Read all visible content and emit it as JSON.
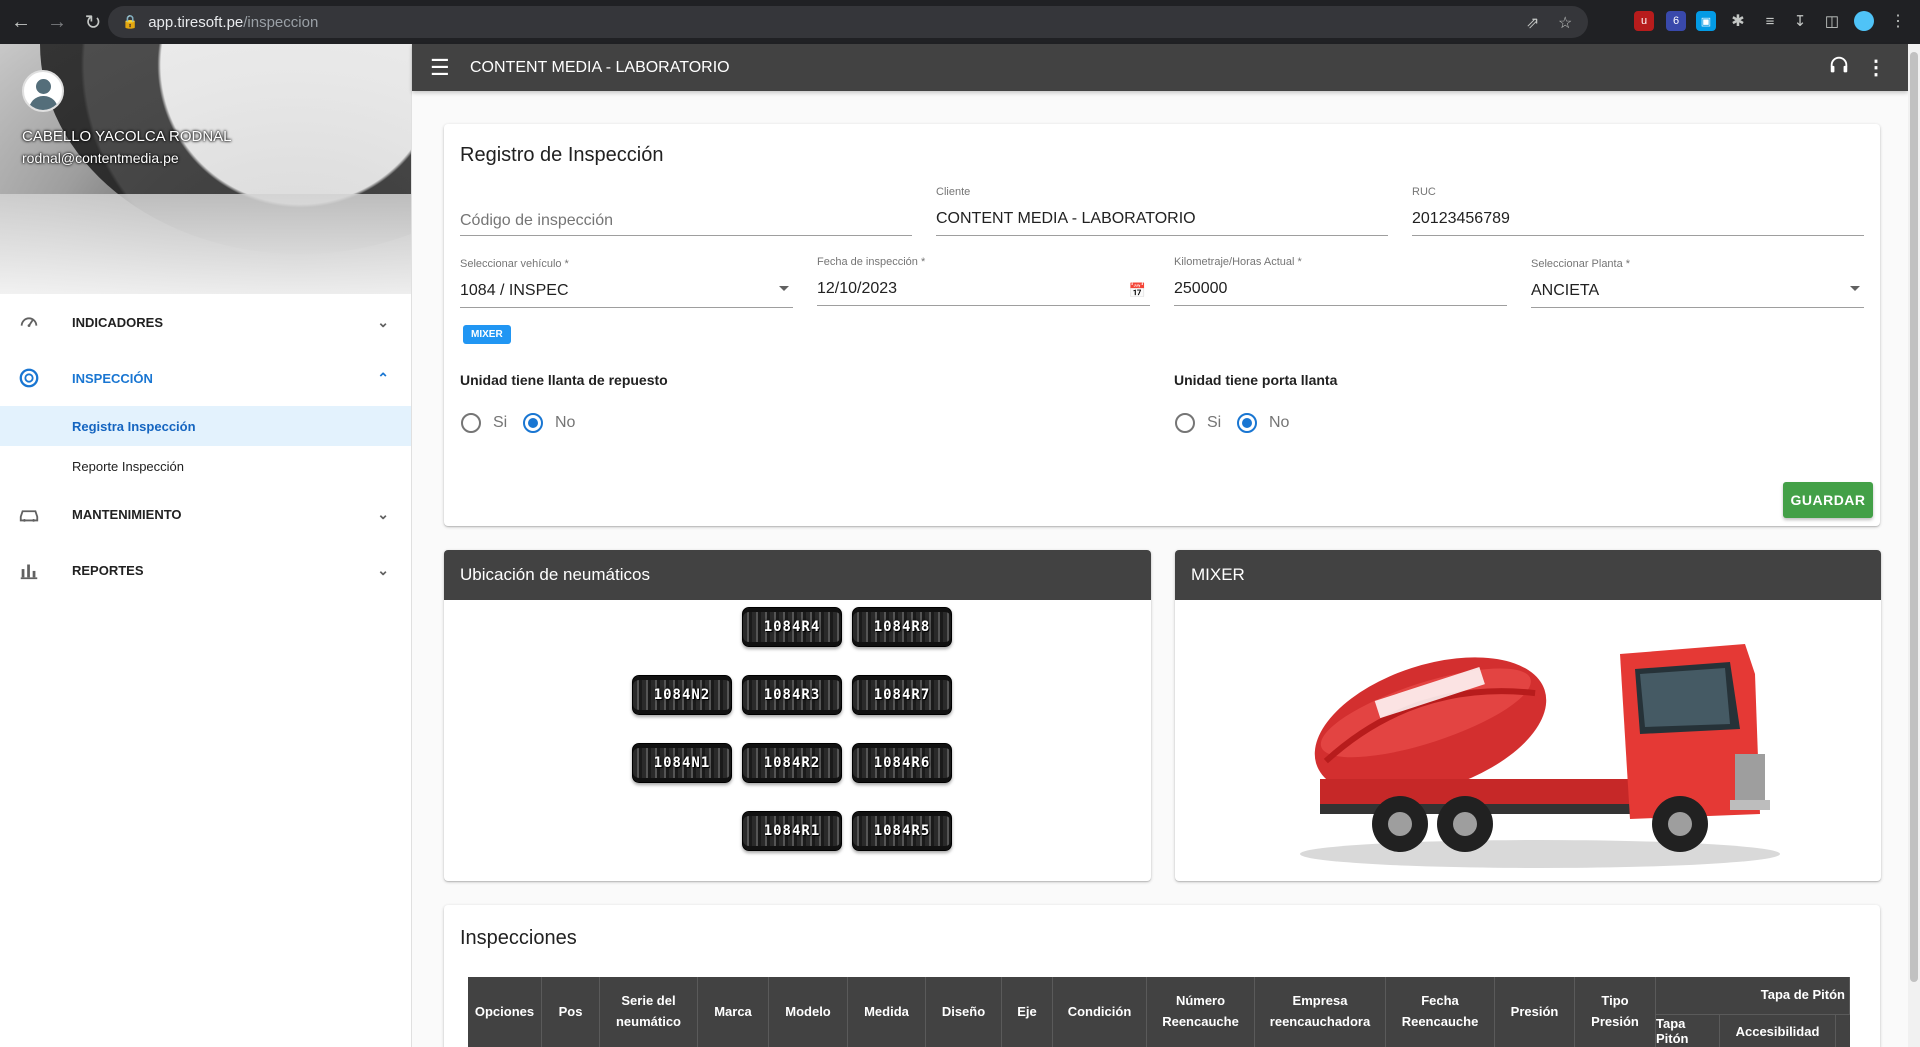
{
  "browser": {
    "url_host": "app.tiresoft.pe",
    "url_path": "/inspeccion"
  },
  "user": {
    "name": "CABELLO YACOLCA RODNAL",
    "email": "rodnal@contentmedia.pe"
  },
  "sidebar": {
    "items": [
      {
        "label": "INDICADORES",
        "icon": "speedometer-icon"
      },
      {
        "label": "INSPECCIÓN",
        "icon": "tire-inspection-icon",
        "subitems": [
          "Registra Inspección",
          "Reporte Inspección"
        ]
      },
      {
        "label": "MANTENIMIENTO",
        "icon": "car-repair-icon"
      },
      {
        "label": "REPORTES",
        "icon": "bar-chart-icon"
      }
    ]
  },
  "appbar": {
    "title": "CONTENT MEDIA - LABORATORIO"
  },
  "form": {
    "title": "Registro de Inspección",
    "codigo_placeholder": "Código de inspección",
    "cliente_label": "Cliente",
    "cliente_value": "CONTENT MEDIA - LABORATORIO",
    "ruc_label": "RUC",
    "ruc_value": "20123456789",
    "vehiculo_label": "Seleccionar vehículo *",
    "vehiculo_value": "1084 / INSPEC",
    "fecha_label": "Fecha de inspección *",
    "fecha_value": "12/10/2023",
    "km_label": "Kilometraje/Horas Actual *",
    "km_value": "250000",
    "planta_label": "Seleccionar Planta *",
    "planta_value": "ANCIETA",
    "chip": "MIXER",
    "repuesto_label": "Unidad tiene llanta de repuesto",
    "porta_label": "Unidad tiene porta llanta",
    "si": "Si",
    "no": "No",
    "save": "GUARDAR"
  },
  "ubicacion": {
    "title": "Ubicación de neumáticos",
    "tires": [
      "1084R4",
      "1084R8",
      "1084N2",
      "1084R3",
      "1084R7",
      "1084N1",
      "1084R2",
      "1084R6",
      "1084R1",
      "1084R5"
    ]
  },
  "vehicle_card": {
    "title": "MIXER"
  },
  "inspecciones": {
    "title": "Inspecciones",
    "headers": [
      "Opciones",
      "Pos",
      "Serie del neumático",
      "Marca",
      "Modelo",
      "Medida",
      "Diseño",
      "Eje",
      "Condición",
      "Número Reencauche",
      "Empresa reencauchadora",
      "Fecha Reencauche",
      "Presión",
      "Tipo Presión"
    ],
    "group_header": "Tapa de Pitón",
    "sub_headers": [
      "Tapa Pitón",
      "Accesibilidad"
    ]
  }
}
